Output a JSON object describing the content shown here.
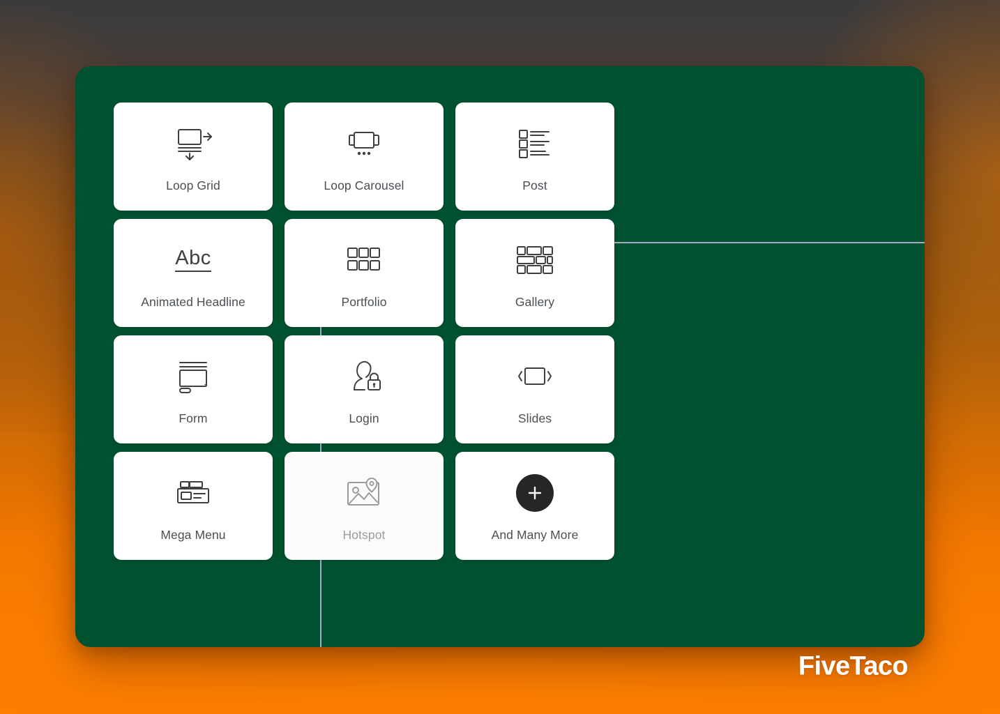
{
  "background": {
    "top_color": "#3a3a3c",
    "bottom_color": "#ff8200",
    "accent_orange": "#ef7600"
  },
  "panel": {
    "background_color": "#005130",
    "guide_line_color": "#b9b6d8"
  },
  "brand": {
    "name": "FiveTaco",
    "color": "#ffffff"
  },
  "widget_grid": {
    "columns": 3,
    "rows": 4,
    "cards": [
      {
        "label": "Loop Grid",
        "icon": "loop-grid-icon",
        "state": "normal"
      },
      {
        "label": "Loop Carousel",
        "icon": "loop-carousel-icon",
        "state": "normal"
      },
      {
        "label": "Post",
        "icon": "post-list-icon",
        "state": "normal"
      },
      {
        "label": "Animated Headline",
        "icon": "animated-headline-icon",
        "state": "normal"
      },
      {
        "label": "Portfolio",
        "icon": "portfolio-grid-icon",
        "state": "normal"
      },
      {
        "label": "Gallery",
        "icon": "gallery-masonry-icon",
        "state": "normal"
      },
      {
        "label": "Form",
        "icon": "form-icon",
        "state": "normal"
      },
      {
        "label": "Login",
        "icon": "login-user-lock-icon",
        "state": "normal"
      },
      {
        "label": "Slides",
        "icon": "slides-icon",
        "state": "normal"
      },
      {
        "label": "Mega Menu",
        "icon": "mega-menu-icon",
        "state": "normal"
      },
      {
        "label": "Hotspot",
        "icon": "hotspot-image-pin-icon",
        "state": "faded"
      },
      {
        "label": "And Many More",
        "icon": "plus-circle-icon",
        "state": "normal"
      }
    ]
  }
}
